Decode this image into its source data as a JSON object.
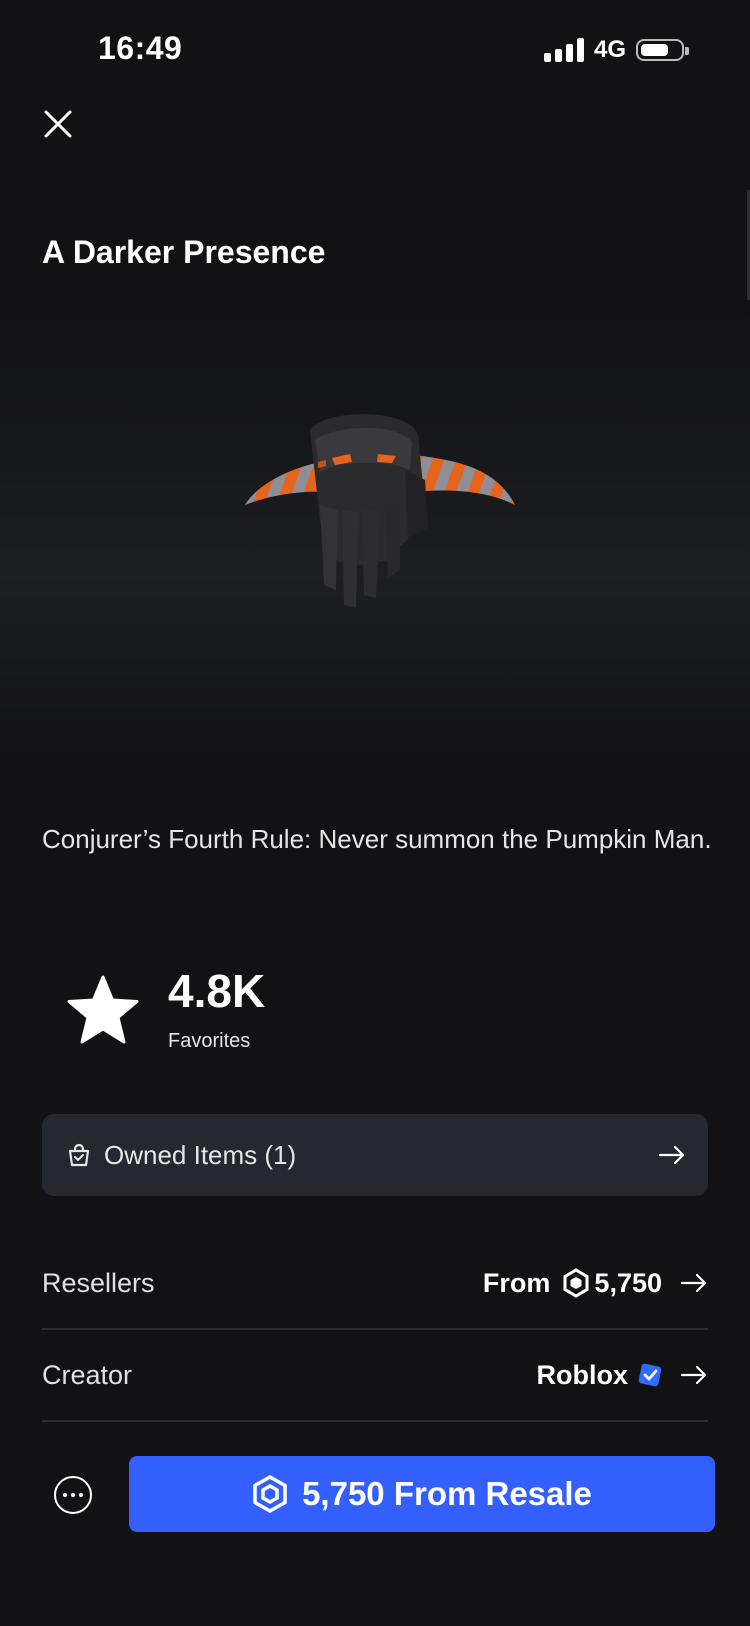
{
  "status_bar": {
    "time": "16:49",
    "network": "4G",
    "battery_level": 0.7
  },
  "header": {
    "close_icon": "close-icon"
  },
  "item": {
    "title": "A Darker Presence",
    "description": "Conjurer’s Fourth Rule: Never summon the Pumpkin Man."
  },
  "favorites": {
    "count": "4.8K",
    "label": "Favorites"
  },
  "owned": {
    "label": "Owned Items (1)"
  },
  "resellers": {
    "label": "Resellers",
    "from_label": "From",
    "price": "5,750"
  },
  "creator": {
    "label": "Creator",
    "name": "Roblox",
    "verified": true
  },
  "purchase": {
    "button_label": "5,750 From Resale"
  },
  "colors": {
    "background": "#121215",
    "accent": "#335fff",
    "row_background": "#262830",
    "verified_badge": "#2f6bff",
    "item_orange": "#e8641c"
  }
}
